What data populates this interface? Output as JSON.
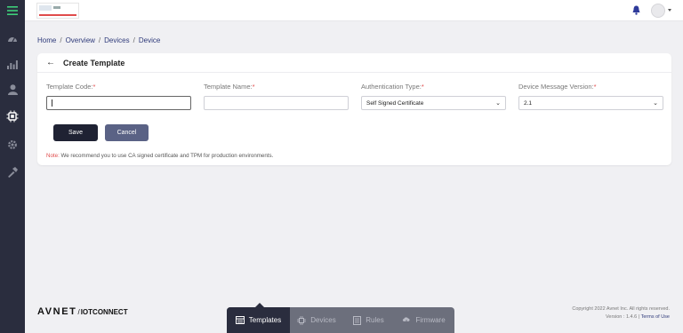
{
  "sidebar": {
    "items": [
      {
        "icon": "menu-icon",
        "active": true
      },
      {
        "icon": "dashboard-icon"
      },
      {
        "icon": "analytics-icon"
      },
      {
        "icon": "user-icon"
      },
      {
        "icon": "device-chip-icon",
        "active": true
      },
      {
        "icon": "settings-icon"
      },
      {
        "icon": "tools-icon"
      }
    ]
  },
  "breadcrumb": [
    "Home",
    "Overview",
    "Devices",
    "Device"
  ],
  "page": {
    "title": "Create Template",
    "fields": {
      "template_code": {
        "label": "Template Code:",
        "value": ""
      },
      "template_name": {
        "label": "Template Name:",
        "value": ""
      },
      "auth_type": {
        "label": "Authentication Type:",
        "value": "Self Signed Certificate"
      },
      "msg_version": {
        "label": "Device Message Version:",
        "value": "2.1"
      }
    },
    "required_mark": "*",
    "save_label": "Save",
    "cancel_label": "Cancel",
    "note_label": "Note:",
    "note_text": "We recommend you to use CA signed certificate and TPM for production environments."
  },
  "footer": {
    "brand": "AVNET",
    "slash": "/",
    "sub": "IOTCONNECT",
    "copyright": "Copyright 2022 Avnet Inc. All rights reserved.",
    "version": "Version : 1.4.6",
    "version_sep": "|",
    "terms": "Terms of Use"
  },
  "bottom_tabs": [
    {
      "label": "Templates",
      "icon": "templates-icon",
      "active": true
    },
    {
      "label": "Devices",
      "icon": "devices-icon"
    },
    {
      "label": "Rules",
      "icon": "rules-icon"
    },
    {
      "label": "Firmware",
      "icon": "firmware-icon"
    }
  ],
  "colors": {
    "sidebar_bg": "#2a2d3e",
    "active_green": "#3ecf7a",
    "required_red": "#e04c4c",
    "link_blue": "#2e3a7a",
    "save_bg": "#1f2233",
    "cancel_bg": "#5a6285"
  }
}
